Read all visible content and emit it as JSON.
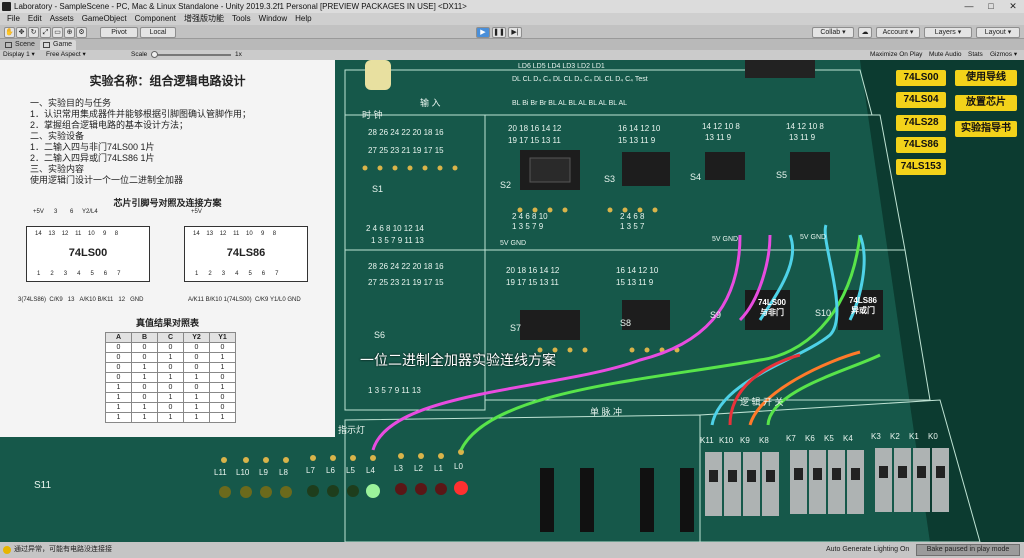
{
  "window": {
    "title": "Laboratory - SampleScene - PC, Mac & Linux Standalone - Unity 2019.3.2f1 Personal [PREVIEW PACKAGES IN USE] <DX11>",
    "controls": [
      "—",
      "□",
      "✕"
    ]
  },
  "menu": [
    "File",
    "Edit",
    "Assets",
    "GameObject",
    "Component",
    "增强版功能",
    "Tools",
    "Window",
    "Help"
  ],
  "toolbar": {
    "pivot": "Pivot",
    "local": "Local",
    "play": "▶",
    "pause": "❚❚",
    "step": "▶|",
    "collab": "Collab ▾",
    "account": "Account ▾",
    "layers": "Layers ▾",
    "layout": "Layout ▾"
  },
  "tabs": {
    "scene": "Scene",
    "game": "Game"
  },
  "game_bar": {
    "display": "Display 1",
    "aspect": "Free Aspect",
    "scale_label": "Scale",
    "scale_value": "1x",
    "maximize": "Maximize On Play",
    "mute": "Mute Audio",
    "stats": "Stats",
    "gizmos": "Gizmos ▾"
  },
  "panel": {
    "title": "实验名称：组合逻辑电路设计",
    "lines": [
      "一、实验目的与任务",
      "1．认识常用集成器件并能够根据引脚图确认管脚作用；",
      "2．掌握组合逻辑电路的基本设计方法；",
      "二、实验设备",
      "1．二输入四与非门74LS00    1片",
      "2．二输入四异或门74LS86    1片",
      "三、实验内容",
      "使用逻辑门设计一个一位二进制全加器"
    ],
    "pin_title": "芯片引脚号对照及连接方案",
    "chip1": {
      "name": "74LS00",
      "top_labels": [
        "+5V",
        "3",
        "6",
        "Y2/L4"
      ],
      "top_pins": [
        "14",
        "13",
        "12",
        "11",
        "10",
        "9",
        "8"
      ],
      "bottom_pins": [
        "1",
        "2",
        "3",
        "4",
        "5",
        "6",
        "7"
      ],
      "bottom_labels": [
        "3(74LS86)",
        "C/K9",
        "13",
        "A/K10",
        "B/K11",
        "12",
        "GND"
      ]
    },
    "chip2": {
      "name": "74LS86",
      "top_labels": [
        "+5V"
      ],
      "top_pins": [
        "14",
        "13",
        "12",
        "11",
        "10",
        "9",
        "8"
      ],
      "bottom_pins": [
        "1",
        "2",
        "3",
        "4",
        "5",
        "6",
        "7"
      ],
      "bottom_labels": [
        "A/K11",
        "B/K10",
        "1(74LS00)",
        "C/K9",
        "Y1/L0",
        "GND"
      ]
    },
    "truth_title": "真值结果对照表",
    "truth_headers": [
      "A",
      "B",
      "C",
      "Y2",
      "Y1"
    ],
    "truth_rows": [
      [
        "0",
        "0",
        "0",
        "0",
        "0"
      ],
      [
        "0",
        "0",
        "1",
        "0",
        "1"
      ],
      [
        "0",
        "1",
        "0",
        "0",
        "1"
      ],
      [
        "0",
        "1",
        "1",
        "1",
        "0"
      ],
      [
        "1",
        "0",
        "0",
        "0",
        "1"
      ],
      [
        "1",
        "0",
        "1",
        "1",
        "0"
      ],
      [
        "1",
        "1",
        "0",
        "1",
        "0"
      ],
      [
        "1",
        "1",
        "1",
        "1",
        "1"
      ]
    ]
  },
  "right_buttons": {
    "chips": [
      "74LS00",
      "74LS04",
      "74LS28",
      "74LS86",
      "74LS153"
    ],
    "actions": [
      "使用导线",
      "放置芯片",
      "实验指导书"
    ]
  },
  "board": {
    "caption": "一位二进制全加器实验连线方案",
    "clock_label": "时  钟",
    "input_label": "输  入",
    "indicator_label": "指示灯",
    "pulse_label": "单  脉  冲",
    "switch_label": "逻  辑  开  关",
    "top_row": "LD6  LD5     LD4  LD3     LD2  LD1",
    "top_row2": "DL CL D₄ C₄  DL CL D₄ C₄  DL CL D₄ C₄ Test",
    "top_row3": "BL Bi Br Br  BL AL BL AL BL AL BL AL",
    "socket_labels": [
      "S1",
      "S2",
      "S3",
      "S4",
      "S5",
      "S6",
      "S7",
      "S8",
      "S9",
      "S10",
      "S11"
    ],
    "pin_row_a": "28 26 24 22 20 18 16",
    "pin_row_b": "27 25 23 21 19 17 15",
    "pin_row_c": "1 3 5 7 9 11 13",
    "pin_row_d": "2 4 6 8 10 12 14",
    "socket_top": "16 14 12 10",
    "socket_top2": "15 13 11 9",
    "socket_bot": "1 3 5 7",
    "socket_bot2": "2 4 6 8",
    "chip_top_small": "14 12 10 8",
    "chip_top_small2": "13 11 9",
    "socket_top_wide": "20 18 16 14 12",
    "socket_top_wide2": "19 17 15 13 11",
    "socket_bot_wide": "1 3 5 7 9",
    "socket_bot_wide2": "2 4 6 8 10",
    "placed_chip_labels": [
      "74LS00\n与非门",
      "74LS86\n异或门"
    ],
    "power": [
      "5V",
      "GND"
    ],
    "led_labels": [
      "L11",
      "L10",
      "L9",
      "L8",
      "L7",
      "L6",
      "L5",
      "L4",
      "L3",
      "L2",
      "L1",
      "L0"
    ],
    "switch_labels": [
      "K11",
      "K10",
      "K9",
      "K8",
      "K7",
      "K6",
      "K5",
      "K4",
      "K3",
      "K2",
      "K1",
      "K0"
    ]
  },
  "statusbar": {
    "message": "通过异常，可能有电路没连接接",
    "auto_gen": "Auto Generate Lighting On",
    "bake": "Bake paused in play mode"
  },
  "colors": {
    "board_green": "#16584a",
    "button_yellow": "#f3d21a",
    "wire_magenta": "#e84ce0",
    "wire_green": "#58e44a",
    "wire_cyan": "#4ed2e8",
    "wire_red": "#e8323a",
    "play_blue": "#4a8fd9"
  }
}
